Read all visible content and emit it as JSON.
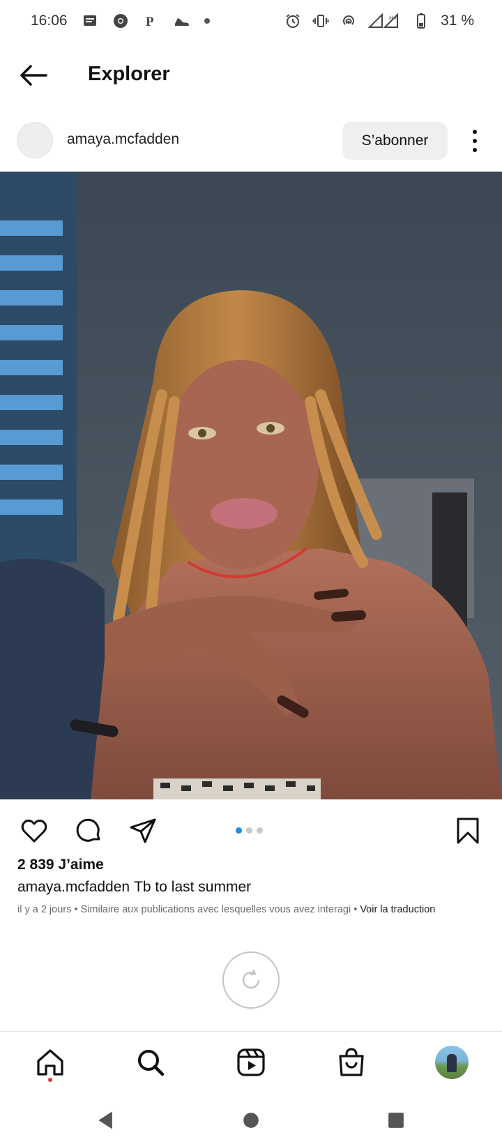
{
  "status_bar": {
    "time": "16:06",
    "battery": "31 %",
    "network_label": "H+",
    "icons": [
      "message-icon",
      "chrome-icon",
      "parking-icon",
      "shoe-icon",
      "dot-icon",
      "alarm-icon",
      "vibrate-icon",
      "hotspot-icon",
      "signal-icon",
      "battery-icon"
    ]
  },
  "header": {
    "title": "Explorer",
    "back_icon": "arrow-left-icon"
  },
  "post": {
    "author": "amaya.mcfadden",
    "follow_label": "S’abonner",
    "image_count": 3,
    "active_image_index": 0,
    "likes": "2 839 J’aime",
    "caption_user": "amaya.mcfadden",
    "caption_text": "Tb to last summer",
    "meta_text": "il y a 2 jours • Similaire aux publications avec lesquelles vous avez interagi •",
    "translate_label": "Voir la traduction"
  },
  "colors": {
    "accent_blue": "#1f8ee8",
    "notification_red": "#e8323a",
    "button_bg": "#efefef"
  },
  "bottom_nav": {
    "items": [
      "home-icon",
      "search-icon",
      "reels-icon",
      "shop-icon",
      "profile-avatar"
    ],
    "active": "home-icon"
  },
  "system_nav": [
    "back-triangle",
    "home-circle",
    "recents-square"
  ]
}
